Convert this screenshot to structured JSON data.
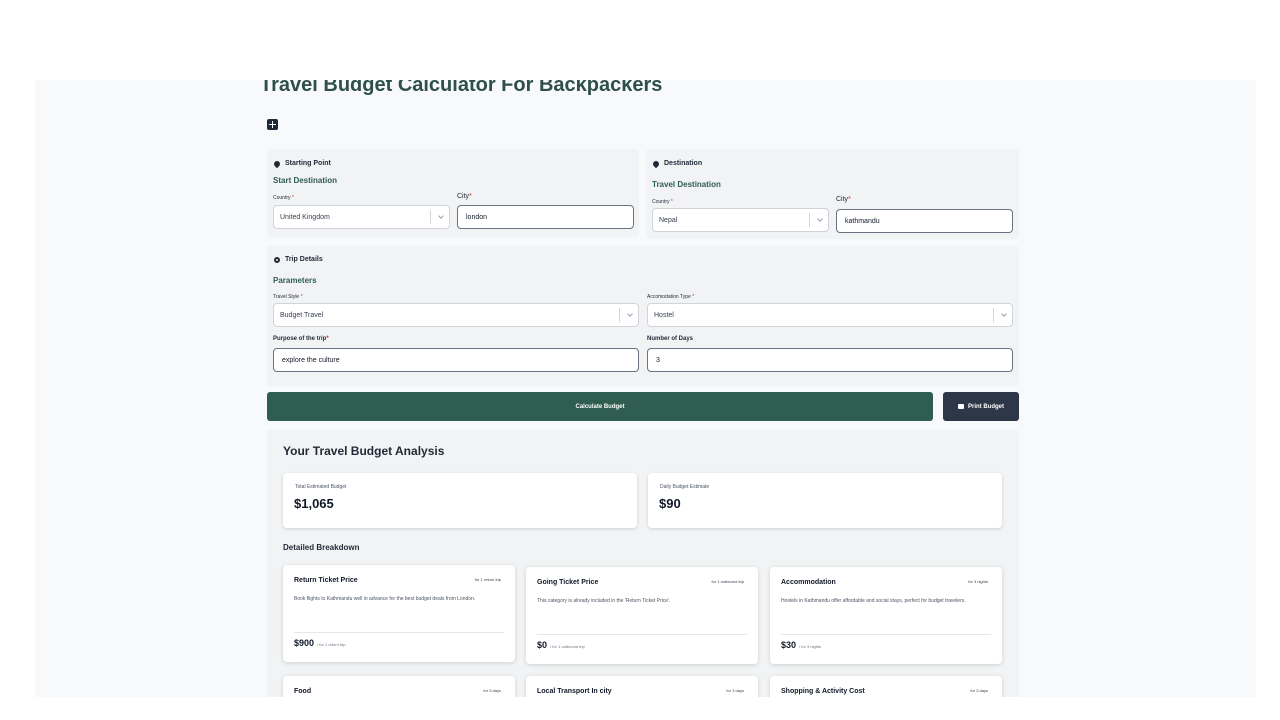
{
  "app": {
    "title": "Travel Budget Calculator For Backpackers"
  },
  "starting_point": {
    "header": "Starting Point",
    "subheader": "Start Destination",
    "country_label": "Country",
    "country_value": "United Kingdom",
    "city_label": "City",
    "city_value": "london"
  },
  "destination": {
    "header": "Destination",
    "subheader": "Travel Destination",
    "country_label": "Country",
    "country_value": "Nepal",
    "city_label": "City",
    "city_value": "kathmandu"
  },
  "trip_details": {
    "header": "Trip Details",
    "subheader": "Parameters",
    "travel_style_label": "Travel Style",
    "travel_style_value": "Budget Travel",
    "accommodation_label": "Accomodation Type",
    "accommodation_value": "Hostel",
    "purpose_label": "Purpose of the trip",
    "purpose_value": "explore the culture",
    "days_label": "Number of Days",
    "days_value": "3"
  },
  "actions": {
    "calculate_label": "Calculate Budget",
    "print_label": "Print Budget"
  },
  "analysis": {
    "title": "Your Travel Budget Analysis",
    "total_label": "Total Estimated Budget",
    "total_value": "$1,065",
    "daily_label": "Daily Budget Estimate",
    "daily_value": "$90",
    "breakdown_title": "Detailed Breakdown",
    "items": [
      {
        "title": "Return Ticket Price",
        "badge": "for 1 return trip",
        "desc": "Book flights to Kathmandu well in advance for the best budget deals from London.",
        "price": "$900",
        "unit": "/ for 1 return trip"
      },
      {
        "title": "Going Ticket Price",
        "badge": "for 1 outbound trip",
        "desc": "This category is already included in the 'Return Ticket Price'.",
        "price": "$0",
        "unit": "/ for 1 outbound trip"
      },
      {
        "title": "Accommodation",
        "badge": "for 3 nights",
        "desc": "Hostels in Kathmandu offer affordable and social stays, perfect for budget travelers.",
        "price": "$30",
        "unit": "/ for 3 nights"
      },
      {
        "title": "Food",
        "badge": "for 3 days"
      },
      {
        "title": "Local Transport In city",
        "badge": "for 3 days"
      },
      {
        "title": "Shopping & Activity Cost",
        "badge": "for 3 days"
      }
    ]
  },
  "icons": {
    "pin": "map-pin-icon",
    "gear": "gear-icon",
    "grid": "calculator-icon",
    "printer": "printer-icon"
  },
  "colors": {
    "accent": "#2f5d50",
    "dark_button": "#2d3748",
    "required": "#dc2626"
  }
}
